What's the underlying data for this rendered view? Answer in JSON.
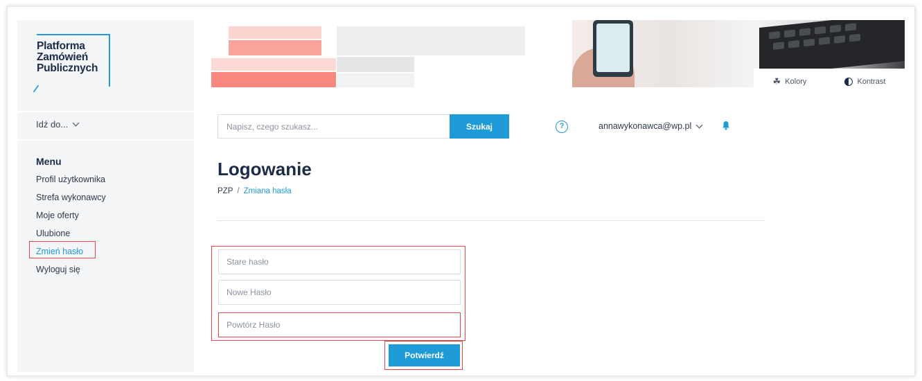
{
  "logo": {
    "lines": [
      "Platforma",
      "Zamówień",
      "Publicznych"
    ]
  },
  "sidebar": {
    "goto_label": "Idź do...",
    "menu_title": "Menu",
    "items": [
      {
        "label": "Profil użytkownika"
      },
      {
        "label": "Strefa wykonawcy"
      },
      {
        "label": "Moje oferty"
      },
      {
        "label": "Ulubione"
      },
      {
        "label": "Zmień hasło",
        "active": true
      },
      {
        "label": "Wyloguj się"
      }
    ]
  },
  "toolbar": {
    "colors_label": "Kolory",
    "contrast_label": "Kontrast"
  },
  "search": {
    "placeholder": "Napisz, czego szukasz...",
    "button_label": "Szukaj"
  },
  "header": {
    "help_symbol": "?",
    "user_email": "annawykonawca@wp.pl"
  },
  "main": {
    "title": "Logowanie",
    "breadcrumb": {
      "root": "PZP",
      "separator": "/",
      "current": "Zmiana hasła"
    },
    "form": {
      "old_password_placeholder": "Stare hasło",
      "new_password_placeholder": "Nowe Hasło",
      "repeat_password_placeholder": "Powtórz Hasło",
      "confirm_label": "Potwierdź"
    }
  },
  "colors": {
    "accent": "#1e9bd7",
    "highlight": "#e2454a",
    "sidebar_bg": "#f3f5f7",
    "title": "#1c2b4a"
  },
  "icons": {
    "colors": "palette-icon",
    "contrast": "contrast-icon",
    "help": "help-icon",
    "notifications": "bell-icon",
    "dropdown": "chevron-down-icon"
  }
}
